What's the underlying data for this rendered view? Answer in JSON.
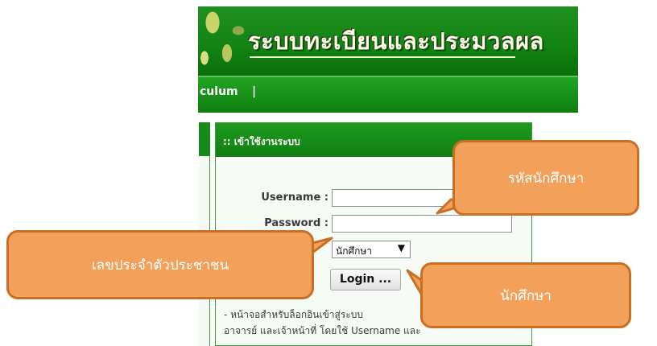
{
  "header": {
    "title": "ระบบทะเบียนและประมวลผล",
    "nav_partial": "culum",
    "nav_separator": "|"
  },
  "login_panel": {
    "title": ":: เข้าใช้งานระบบ",
    "username_label": "Username :",
    "username_value": "",
    "password_label": "Password :",
    "password_value": "",
    "user_type_selected": "นักศึกษา",
    "login_button": "Login ...",
    "description_line1": "- หน้าจอสำหรับล็อกอินเข้าสู่ระบบ",
    "description_line2": "อาจารย์ และเจ้าหน้าที่ โดยใช้ Username และ"
  },
  "annotations": {
    "username_callout": "รหัสนักศึกษา",
    "password_callout": "เลขประจำตัวประชาชน",
    "user_type_callout": "นักศึกษา",
    "color_fill": "#f2a05a",
    "color_border": "#c96f24"
  },
  "theme": {
    "header_green": "#148414",
    "panel_bg": "#f7fbf6"
  },
  "icons": {
    "select_arrow": "dropdown-arrow-icon"
  }
}
